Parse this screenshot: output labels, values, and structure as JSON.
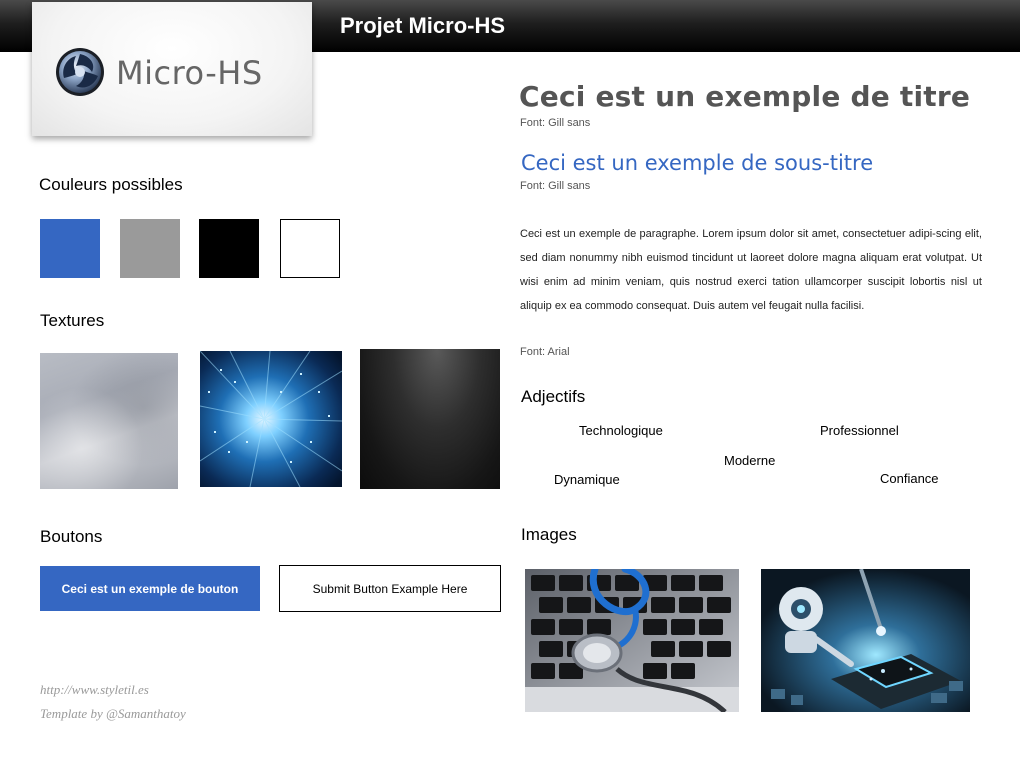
{
  "header": {
    "project_title": "Projet Micro-HS"
  },
  "logo": {
    "text": "Micro-HS"
  },
  "colors": {
    "heading": "Couleurs possibles",
    "swatches": [
      "#3567c2",
      "#9a9a9a",
      "#000000",
      "#ffffff"
    ]
  },
  "textures": {
    "heading": "Textures"
  },
  "buttons": {
    "heading": "Boutons",
    "primary_label": "Ceci est un exemple de bouton",
    "secondary_label": "Submit Button Example Here"
  },
  "credits": {
    "url": "http://www.styletil.es",
    "template": "Template by @Samanthatoy"
  },
  "typography": {
    "title": "Ceci est un exemple de titre",
    "title_font": "Font: Gill sans",
    "subtitle": "Ceci est un exemple de sous-titre",
    "subtitle_font": "Font: Gill sans",
    "paragraph": "Ceci est un exemple de paragraphe. Lorem ipsum dolor sit amet, consectetuer adipi-scing elit, sed diam nonummy nibh euismod tincidunt ut laoreet dolore magna aliquam erat volutpat. Ut wisi enim ad minim veniam, quis nostrud exerci tation ullamcorper suscipit lobortis nisl ut aliquip ex ea commodo consequat. Duis autem vel feugait nulla facilisi.",
    "paragraph_font": "Font: Arial"
  },
  "adjectives": {
    "heading": "Adjectifs",
    "words": [
      "Technologique",
      "Professionnel",
      "Moderne",
      "Dynamique",
      "Confiance"
    ]
  },
  "images": {
    "heading": "Images"
  }
}
